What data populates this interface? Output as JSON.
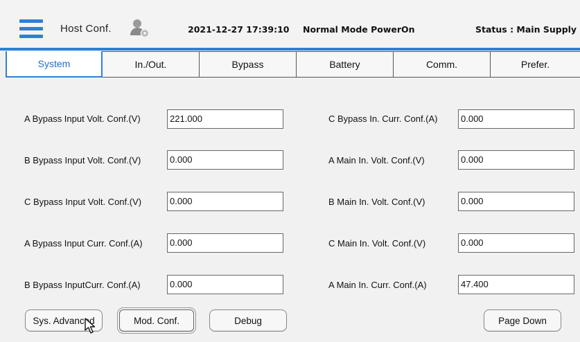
{
  "header": {
    "title": "Host Conf.",
    "datetime": "2021-12-27 17:39:10",
    "mode": "Normal Mode  PowerOn",
    "status": "Status : Main Supply",
    "icons": [
      "hamburger-menu-icon",
      "user-settings-icon"
    ],
    "accent_color": "#2f7fd6"
  },
  "tabs": [
    {
      "label": "System",
      "active": true
    },
    {
      "label": "In./Out.",
      "active": false
    },
    {
      "label": "Bypass",
      "active": false
    },
    {
      "label": "Battery",
      "active": false
    },
    {
      "label": "Comm.",
      "active": false
    },
    {
      "label": "Prefer.",
      "active": false
    }
  ],
  "fields": {
    "left": [
      {
        "label": "A Bypass Input Volt. Conf.(V)",
        "value": "221.000"
      },
      {
        "label": "B Bypass Input Volt. Conf.(V)",
        "value": "0.000"
      },
      {
        "label": "C Bypass Input Volt. Conf.(V)",
        "value": "0.000"
      },
      {
        "label": "A Bypass Input Curr. Conf.(A)",
        "value": "0.000"
      },
      {
        "label": "B Bypass InputCurr. Conf.(A)",
        "value": "0.000"
      }
    ],
    "right": [
      {
        "label": "C Bypass In. Curr. Conf.(A)",
        "value": "0.000"
      },
      {
        "label": "A Main In. Volt. Conf.(V)",
        "value": "0.000"
      },
      {
        "label": "B Main In. Volt. Conf.(V)",
        "value": "0.000"
      },
      {
        "label": "C Main In. Volt. Conf.(V)",
        "value": "0.000"
      },
      {
        "label": "A Main In. Curr. Conf.(A)",
        "value": "47.400"
      }
    ]
  },
  "buttons": {
    "sys_advanced": "Sys. Advanced",
    "mod_conf": "Mod. Conf.",
    "debug": "Debug",
    "page_down": "Page Down"
  }
}
